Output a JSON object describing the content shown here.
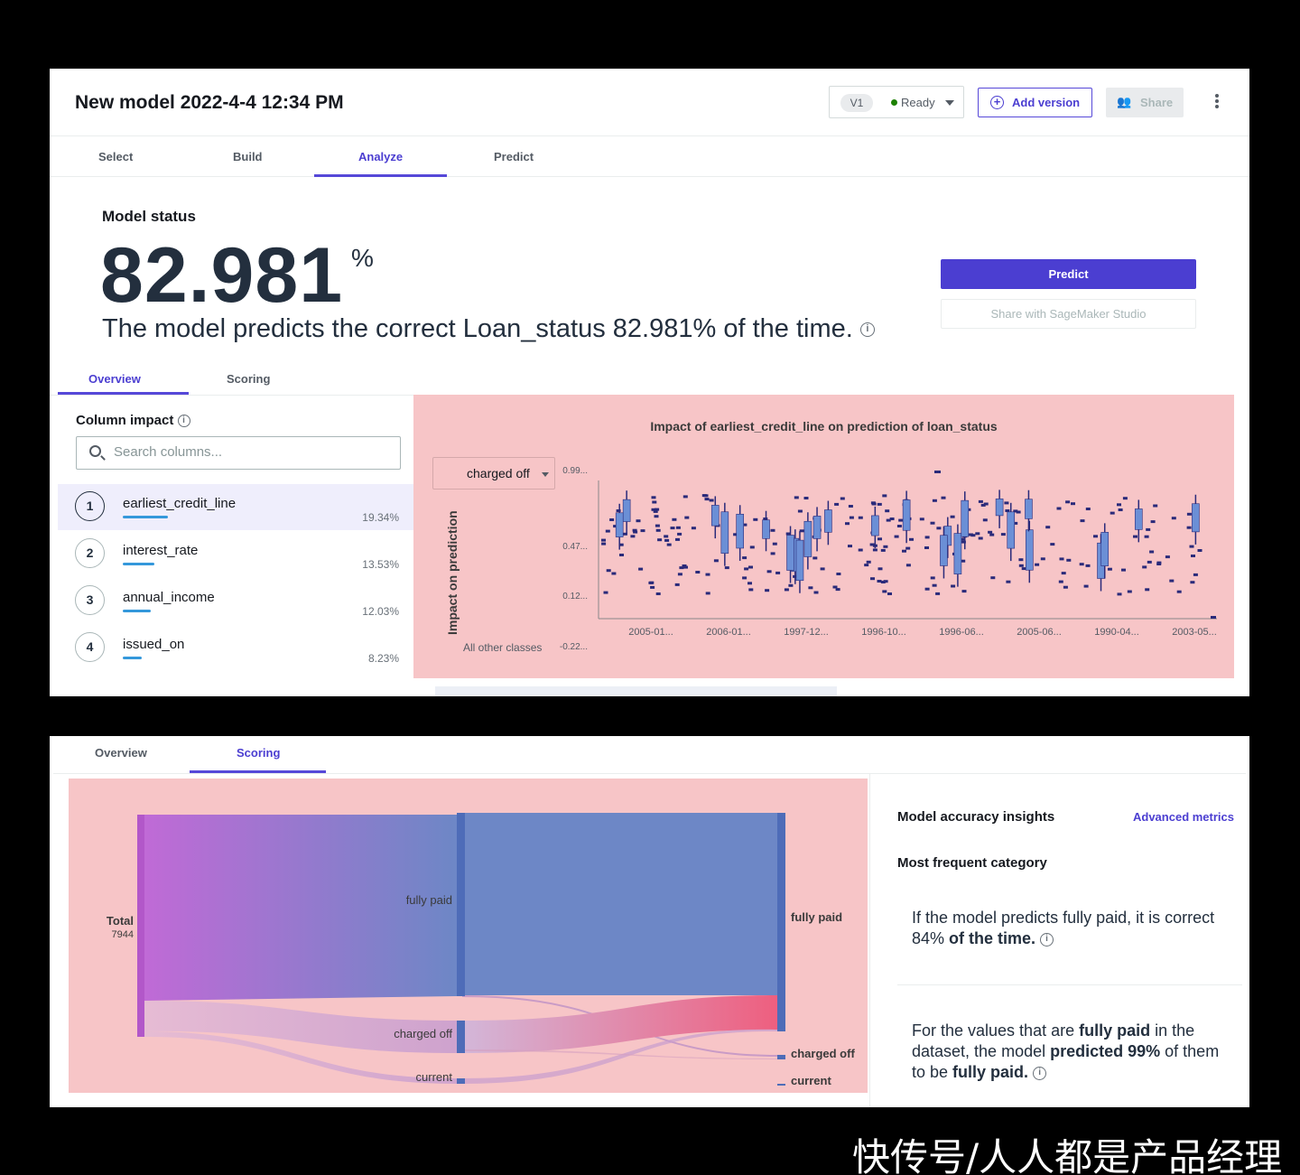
{
  "header": {
    "title": "New model 2022-4-4 12:34 PM",
    "version": "V1",
    "status": "Ready",
    "add_version": "Add version",
    "share": "Share"
  },
  "tabs": [
    "Select",
    "Build",
    "Analyze",
    "Predict"
  ],
  "active_tab": "Analyze",
  "model_status": {
    "label": "Model status",
    "accuracy": "82.981",
    "unit": "%",
    "sentence": "The model predicts the correct Loan_status 82.981% of the time."
  },
  "actions": {
    "predict": "Predict",
    "share_studio": "Share with SageMaker Studio"
  },
  "sub_tabs": [
    "Overview",
    "Scoring"
  ],
  "column_impact": {
    "label": "Column impact",
    "search_placeholder": "Search columns...",
    "columns": [
      {
        "rank": "1",
        "name": "earliest_credit_line",
        "value": "19.34%",
        "fraction": 0.1934
      },
      {
        "rank": "2",
        "name": "interest_rate",
        "value": "13.53%",
        "fraction": 0.1353
      },
      {
        "rank": "3",
        "name": "annual_income",
        "value": "12.03%",
        "fraction": 0.1203
      },
      {
        "rank": "4",
        "name": "issued_on",
        "value": "8.23%",
        "fraction": 0.0823
      }
    ]
  },
  "chart": {
    "title": "Impact of earliest_credit_line on prediction of loan_status",
    "class_selected": "charged off",
    "ylabel": "Impact on prediction",
    "other_classes_label": "All other classes"
  },
  "chart_data": {
    "type": "scatter",
    "title": "Impact of earliest_credit_line on prediction of loan_status",
    "ylabel": "Impact on prediction",
    "y_ticks": [
      "0.99...",
      "0.47...",
      "0.12...",
      "-0.22..."
    ],
    "y_tick_values": [
      0.99,
      0.47,
      0.12,
      -0.22
    ],
    "ylim": [
      -0.22,
      0.99
    ],
    "x_ticks": [
      "2005-01...",
      "2006-01...",
      "1997-12...",
      "1996-10...",
      "1996-06...",
      "2005-06...",
      "1990-04...",
      "2003-05..."
    ],
    "points_description": "dense box-and-whisker markers per earliest_credit_line category"
  },
  "scoring": {
    "tabs": [
      "Overview",
      "Scoring"
    ],
    "active": "Scoring",
    "sankey": {
      "total_label": "Total",
      "total_value": "7944",
      "actual": [
        "fully paid",
        "charged off",
        "current"
      ],
      "predicted": [
        "fully paid",
        "charged off",
        "current"
      ]
    },
    "insights": {
      "title": "Model accuracy insights",
      "advanced": "Advanced metrics",
      "most_frequent": "Most frequent category",
      "p1_a": "If the model predicts fully paid, it is correct 84% ",
      "p1_b": "of the time.",
      "p2_a": "For the values that are ",
      "p2_b": "fully paid",
      "p2_c": " in the dataset, the model ",
      "p2_d": "predicted 99%",
      "p2_e": " of them to be ",
      "p2_f": "fully paid.",
      "info": "i"
    }
  },
  "watermark": "快传号/人人都是产品经理",
  "colors": {
    "accent": "#4b3ed1",
    "chart_bg": "#f7c5c7",
    "marker": "#2a2a7a",
    "box": "#6b8fd6",
    "bar": "#3498db"
  }
}
